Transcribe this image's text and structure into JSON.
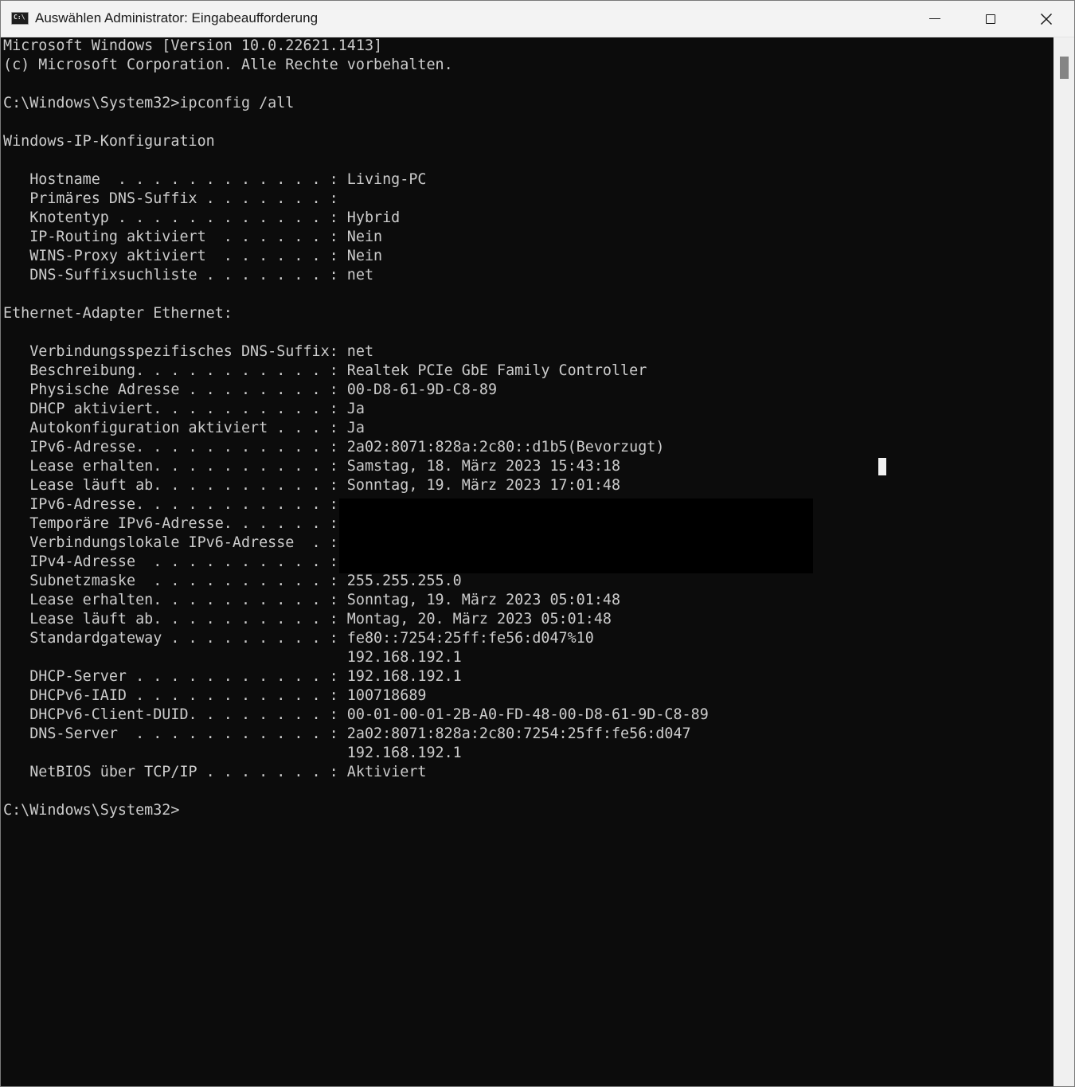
{
  "window": {
    "title": "Auswählen Administrator: Eingabeaufforderung",
    "app_icon": "cmd-icon",
    "app_icon_glyph": "C:\\",
    "controls": [
      "minimize-icon",
      "maximize-icon",
      "close-icon"
    ],
    "close_glyph": "✕"
  },
  "console": {
    "foreground": "#cccccc",
    "background": "#0c0c0c",
    "lines": [
      "Microsoft Windows [Version 10.0.22621.1413]",
      "(c) Microsoft Corporation. Alle Rechte vorbehalten.",
      "",
      "C:\\Windows\\System32>ipconfig /all",
      "",
      "Windows-IP-Konfiguration",
      "",
      "   Hostname  . . . . . . . . . . . . : Living-PC",
      "   Primäres DNS-Suffix . . . . . . . :",
      "   Knotentyp . . . . . . . . . . . . : Hybrid",
      "   IP-Routing aktiviert  . . . . . . : Nein",
      "   WINS-Proxy aktiviert  . . . . . . : Nein",
      "   DNS-Suffixsuchliste . . . . . . . : net",
      "",
      "Ethernet-Adapter Ethernet:",
      "",
      "   Verbindungsspezifisches DNS-Suffix: net",
      "   Beschreibung. . . . . . . . . . . : Realtek PCIe GbE Family Controller",
      "   Physische Adresse . . . . . . . . : 00-D8-61-9D-C8-89",
      "   DHCP aktiviert. . . . . . . . . . : Ja",
      "   Autokonfiguration aktiviert . . . : Ja",
      "   IPv6-Adresse. . . . . . . . . . . : 2a02:8071:828a:2c80::d1b5(Bevorzugt)",
      "   Lease erhalten. . . . . . . . . . : Samstag, 18. März 2023 15:43:18",
      "   Lease läuft ab. . . . . . . . . . : Sonntag, 19. März 2023 17:01:48",
      "   IPv6-Adresse. . . . . . . . . . . :",
      "   Temporäre IPv6-Adresse. . . . . . :",
      "   Verbindungslokale IPv6-Adresse  . :",
      "   IPv4-Adresse  . . . . . . . . . . :",
      "   Subnetzmaske  . . . . . . . . . . : 255.255.255.0",
      "   Lease erhalten. . . . . . . . . . : Sonntag, 19. März 2023 05:01:48",
      "   Lease läuft ab. . . . . . . . . . : Montag, 20. März 2023 05:01:48",
      "   Standardgateway . . . . . . . . . : fe80::7254:25ff:fe56:d047%10",
      "                                       192.168.192.1",
      "   DHCP-Server . . . . . . . . . . . : 192.168.192.1",
      "   DHCPv6-IAID . . . . . . . . . . . : 100718689",
      "   DHCPv6-Client-DUID. . . . . . . . : 00-01-00-01-2B-A0-FD-48-00-D8-61-9D-C8-89",
      "   DNS-Server  . . . . . . . . . . . : 2a02:8071:828a:2c80:7254:25ff:fe56:d047",
      "                                       192.168.192.1",
      "   NetBIOS über TCP/IP . . . . . . . : Aktiviert",
      "",
      "C:\\Windows\\System32>"
    ]
  }
}
